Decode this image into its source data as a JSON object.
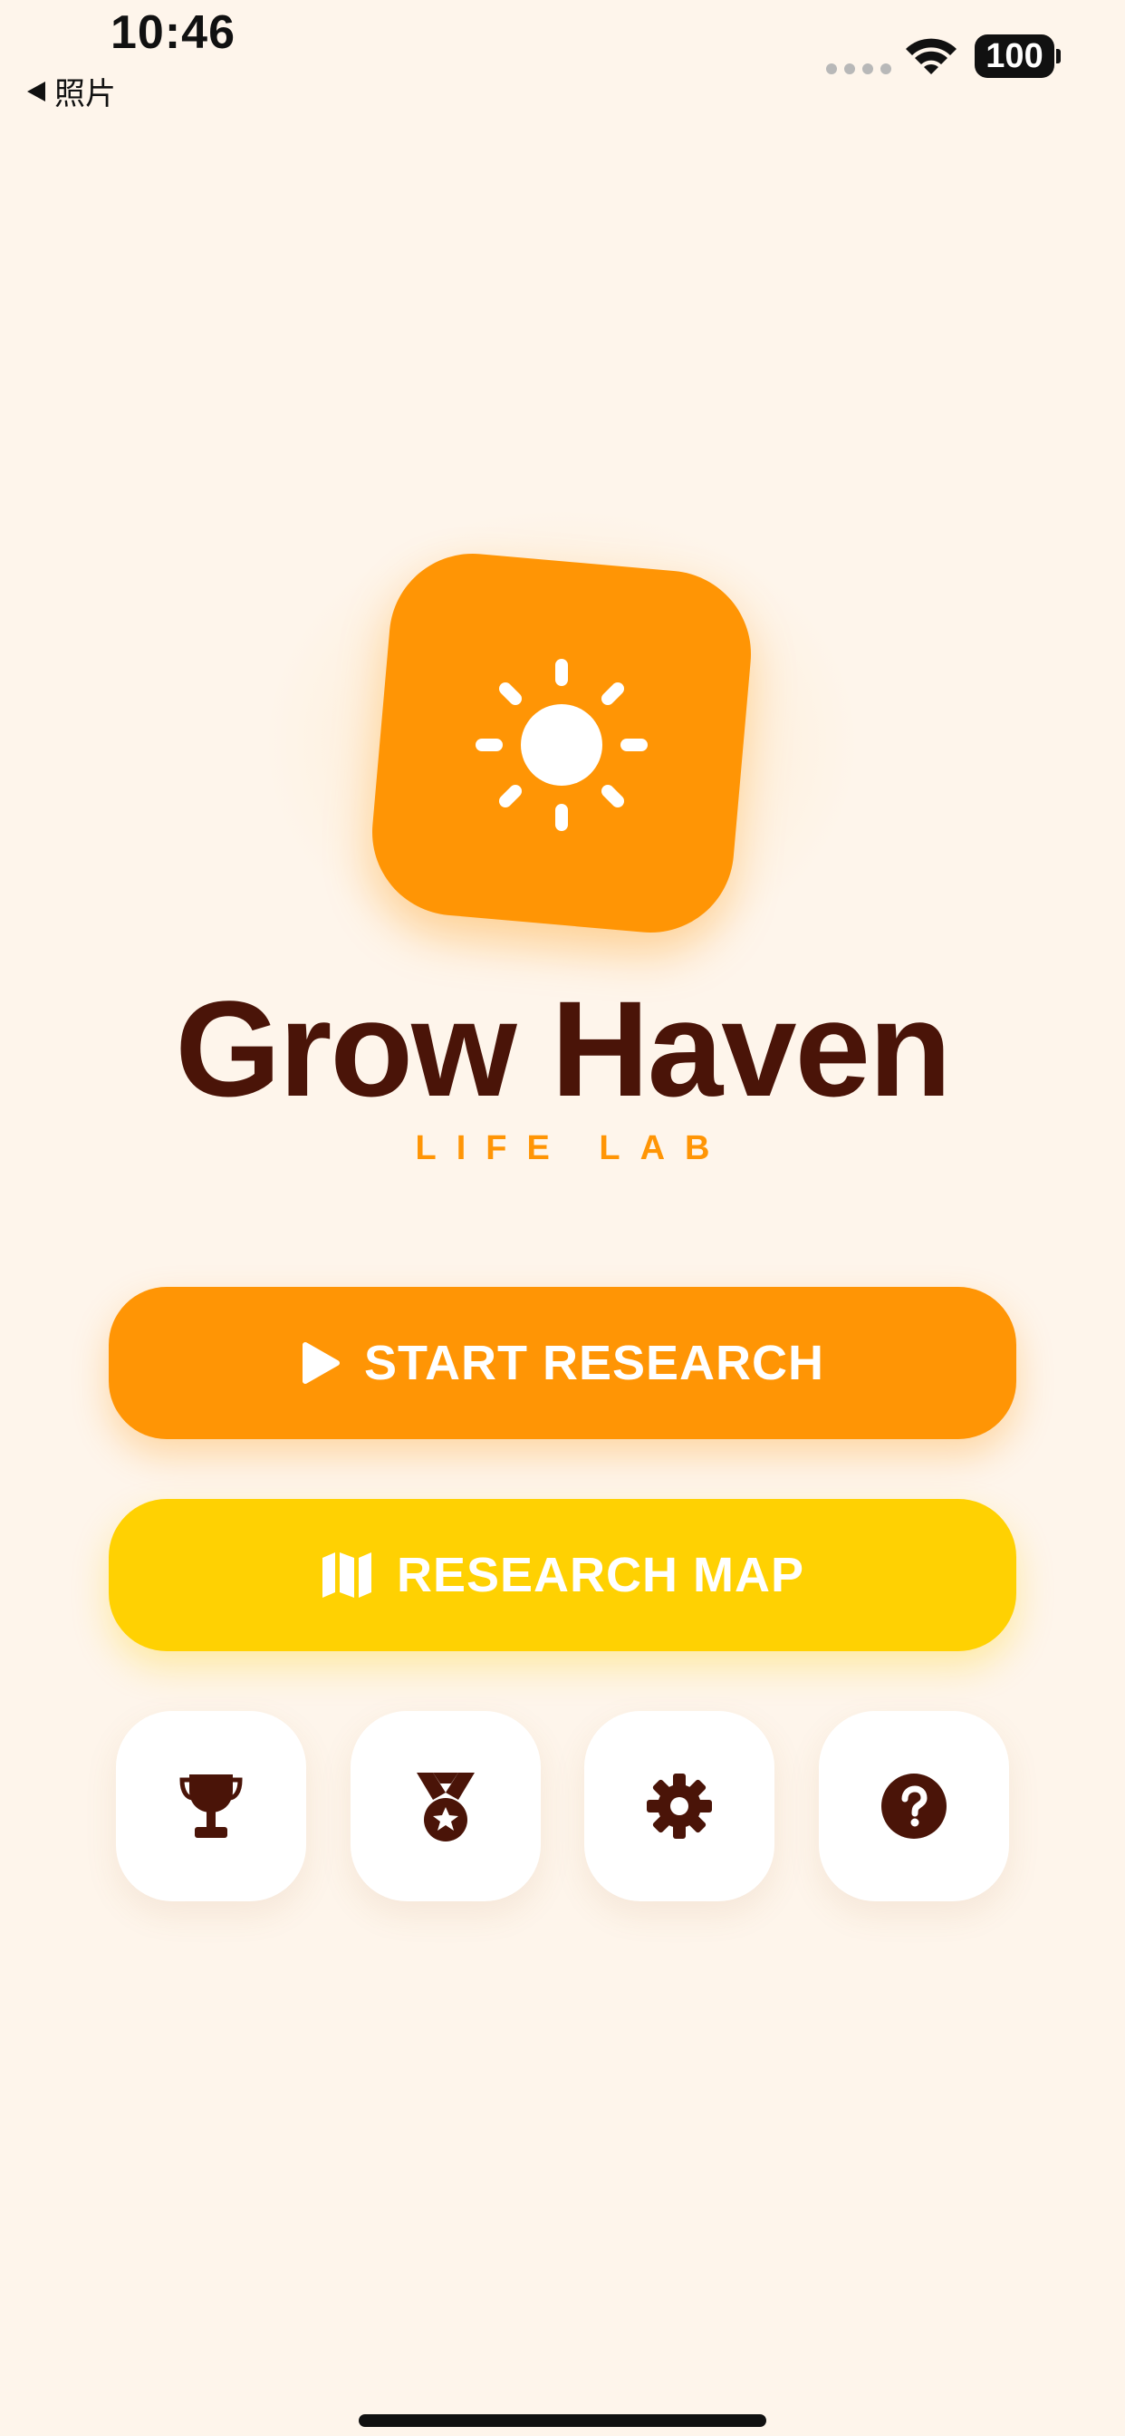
{
  "status_bar": {
    "time": "10:46",
    "back_label": "照片",
    "battery": "100"
  },
  "app": {
    "title": "Grow Haven",
    "subtitle": "LIFE LAB",
    "logo_icon": "sun-icon"
  },
  "buttons": {
    "start": {
      "label": "START RESEARCH",
      "icon": "play-icon"
    },
    "map": {
      "label": "RESEARCH MAP",
      "icon": "map-icon"
    }
  },
  "tiles": [
    {
      "icon": "trophy-icon"
    },
    {
      "icon": "medal-icon"
    },
    {
      "icon": "gear-icon"
    },
    {
      "icon": "question-icon"
    }
  ],
  "colors": {
    "background": "#FEF5EB",
    "primary_orange": "#FF9505",
    "accent_yellow": "#FFD102",
    "text_dark_brown": "#4A1408"
  }
}
